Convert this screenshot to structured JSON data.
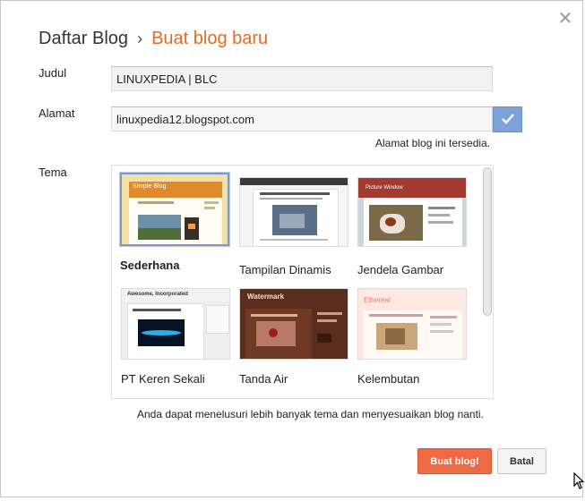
{
  "header": {
    "breadcrumb": "Daftar Blog",
    "separator": "›",
    "current": "Buat blog baru"
  },
  "form": {
    "title_label": "Judul",
    "title_value": "LINUXPEDIA | BLC",
    "address_label": "Alamat",
    "address_value": "linuxpedia12.blogspot.com",
    "address_status": "Alamat blog ini tersedia.",
    "theme_label": "Tema",
    "theme_hint": "Anda dapat menelusuri lebih banyak tema dan menyesuaikan blog nanti."
  },
  "themes": [
    {
      "name": "Sederhana",
      "selected": true,
      "thumb_title": "Simple Blog"
    },
    {
      "name": "Tampilan Dinamis",
      "selected": false
    },
    {
      "name": "Jendela Gambar",
      "selected": false,
      "thumb_title": "Picture Window"
    },
    {
      "name": "PT Keren Sekali",
      "selected": false,
      "thumb_title": "Awesome, Incorporated"
    },
    {
      "name": "Tanda Air",
      "selected": false,
      "thumb_title": "Watermark"
    },
    {
      "name": "Kelembutan",
      "selected": false,
      "thumb_title": "Ethereal"
    }
  ],
  "actions": {
    "create_label": "Buat blog!",
    "cancel_label": "Batal"
  },
  "icons": {
    "close": "close-icon",
    "check": "check-icon",
    "cursor": "mouse-cursor-icon"
  },
  "colors": {
    "accent_orange": "#e66b22",
    "primary_button": "#ee6a42",
    "check_blue": "#7da2d9",
    "selected_border": "#7d98cc"
  }
}
